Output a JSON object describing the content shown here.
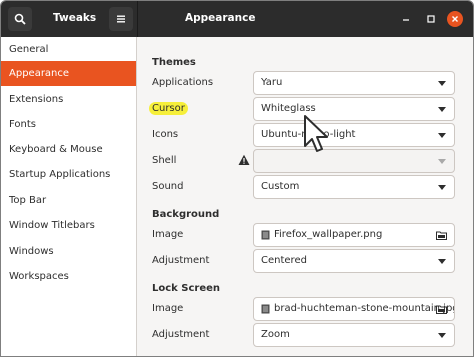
{
  "header": {
    "app_title": "Tweaks",
    "page_title": "Appearance",
    "search_icon": "search-icon",
    "menu_icon": "hamburger-menu-icon"
  },
  "sidebar": {
    "items": [
      {
        "label": "General",
        "active": false
      },
      {
        "label": "Appearance",
        "active": true
      },
      {
        "label": "Extensions",
        "active": false
      },
      {
        "label": "Fonts",
        "active": false
      },
      {
        "label": "Keyboard & Mouse",
        "active": false
      },
      {
        "label": "Startup Applications",
        "active": false
      },
      {
        "label": "Top Bar",
        "active": false
      },
      {
        "label": "Window Titlebars",
        "active": false
      },
      {
        "label": "Windows",
        "active": false
      },
      {
        "label": "Workspaces",
        "active": false
      }
    ]
  },
  "content": {
    "themes": {
      "title": "Themes",
      "applications_label": "Applications",
      "applications_value": "Yaru",
      "cursor_label": "Cursor",
      "cursor_value": "Whiteglass",
      "icons_label": "Icons",
      "icons_value": "Ubuntu-mono-light",
      "shell_label": "Shell",
      "shell_value": "",
      "sound_label": "Sound",
      "sound_value": "Custom"
    },
    "background": {
      "title": "Background",
      "image_label": "Image",
      "image_value": "Firefox_wallpaper.png",
      "adjustment_label": "Adjustment",
      "adjustment_value": "Centered"
    },
    "lock_screen": {
      "title": "Lock Screen",
      "image_label": "Image",
      "image_value": "brad-huchteman-stone-mountain.jpg",
      "adjustment_label": "Adjustment",
      "adjustment_value": "Zoom"
    }
  },
  "colors": {
    "accent": "#e95420",
    "header_bg": "#2c2c2c",
    "highlight": "#f6ef3a"
  }
}
